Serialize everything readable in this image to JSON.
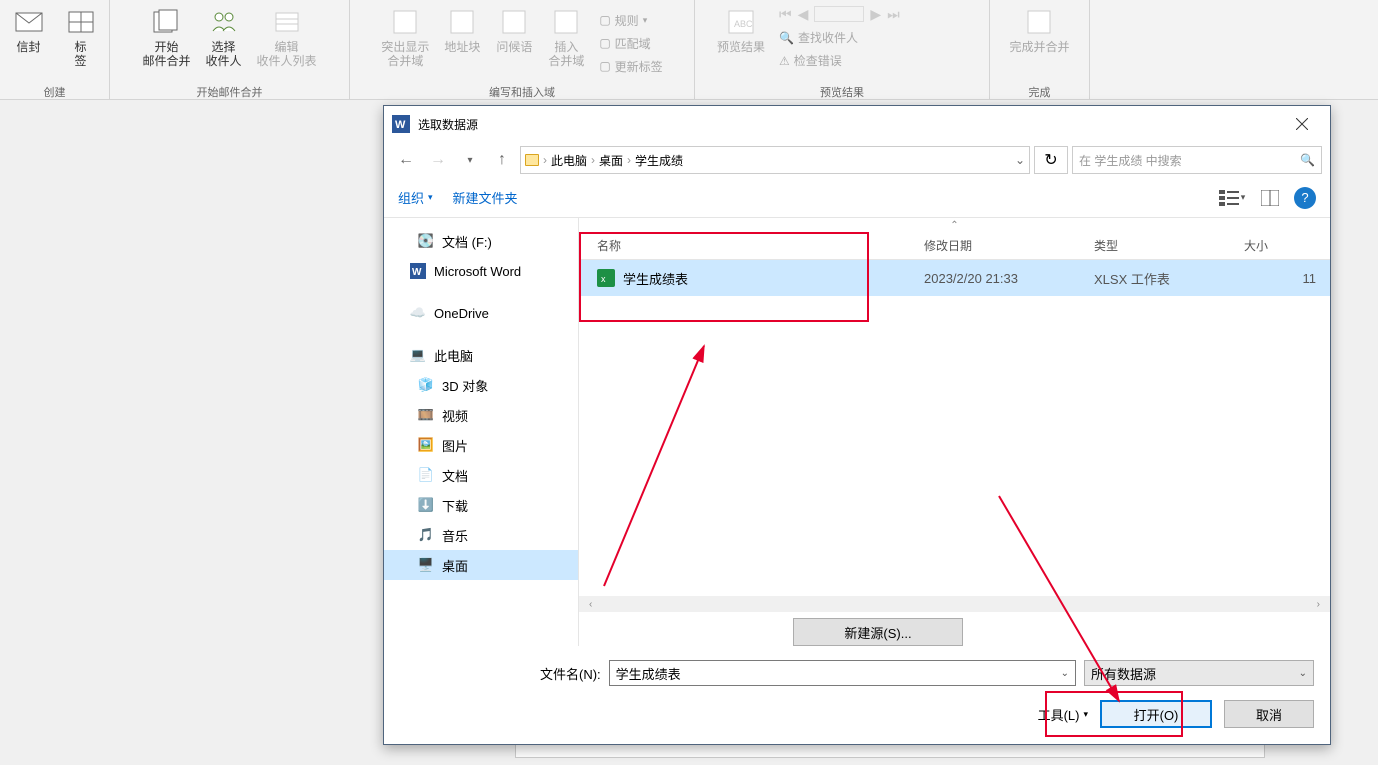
{
  "ribbon": {
    "groups": [
      {
        "label": "创建",
        "items": [
          {
            "label": "信封"
          },
          {
            "label": "标\n签"
          }
        ]
      },
      {
        "label": "开始邮件合并",
        "items": [
          {
            "label": "开始\n邮件合并"
          },
          {
            "label": "选择\n收件人"
          },
          {
            "label": "编辑\n收件人列表",
            "disabled": true
          }
        ]
      },
      {
        "label": "编写和插入域",
        "items": [
          {
            "label": "突出显示\n合并域",
            "disabled": true
          },
          {
            "label": "地址块",
            "disabled": true
          },
          {
            "label": "问候语",
            "disabled": true
          },
          {
            "label": "插入\n合并域",
            "disabled": true
          }
        ],
        "side": [
          {
            "label": "规则",
            "disabled": true
          },
          {
            "label": "匹配域",
            "disabled": true
          },
          {
            "label": "更新标签",
            "disabled": true
          }
        ]
      },
      {
        "label": "预览结果",
        "items": [
          {
            "label": "预览结果",
            "disabled": true
          }
        ],
        "side": [
          {
            "label": "查找收件人",
            "disabled": true
          },
          {
            "label": "检查错误",
            "disabled": true
          }
        ],
        "nav": true
      },
      {
        "label": "完成",
        "items": [
          {
            "label": "完成并合并",
            "disabled": true
          }
        ]
      }
    ]
  },
  "dialog": {
    "title": "选取数据源",
    "breadcrumb": [
      "此电脑",
      "桌面",
      "学生成绩"
    ],
    "search_placeholder": "在 学生成绩 中搜索",
    "organize": "组织",
    "new_folder": "新建文件夹",
    "nav": [
      {
        "label": "文档 (F:)",
        "icon": "disk"
      },
      {
        "label": "Microsoft Word",
        "icon": "word"
      },
      {
        "label": "OneDrive",
        "icon": "cloud"
      },
      {
        "label": "此电脑",
        "icon": "pc"
      },
      {
        "label": "3D 对象",
        "icon": "3d"
      },
      {
        "label": "视频",
        "icon": "video"
      },
      {
        "label": "图片",
        "icon": "pic"
      },
      {
        "label": "文档",
        "icon": "doc"
      },
      {
        "label": "下载",
        "icon": "dl"
      },
      {
        "label": "音乐",
        "icon": "music"
      },
      {
        "label": "桌面",
        "icon": "desktop",
        "selected": true
      }
    ],
    "columns": {
      "name": "名称",
      "date": "修改日期",
      "type": "类型",
      "size": "大小"
    },
    "files": [
      {
        "name": "学生成绩表",
        "date": "2023/2/20 21:33",
        "type": "XLSX 工作表",
        "size": "11"
      }
    ],
    "new_source": "新建源(S)...",
    "filename_label": "文件名(N):",
    "filename_value": "学生成绩表",
    "type_filter": "所有数据源",
    "tools": "工具(L)",
    "open": "打开(O)",
    "cancel": "取消"
  }
}
